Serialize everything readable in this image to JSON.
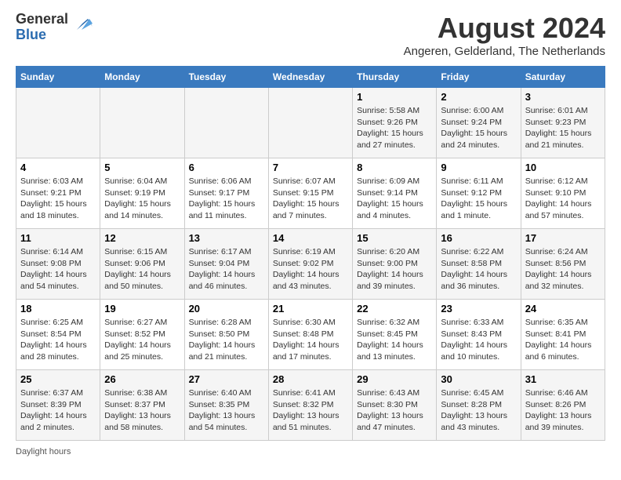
{
  "header": {
    "logo_general": "General",
    "logo_blue": "Blue",
    "month_year": "August 2024",
    "location": "Angeren, Gelderland, The Netherlands"
  },
  "days_of_week": [
    "Sunday",
    "Monday",
    "Tuesday",
    "Wednesday",
    "Thursday",
    "Friday",
    "Saturday"
  ],
  "weeks": [
    [
      {
        "day": "",
        "info": ""
      },
      {
        "day": "",
        "info": ""
      },
      {
        "day": "",
        "info": ""
      },
      {
        "day": "",
        "info": ""
      },
      {
        "day": "1",
        "info": "Sunrise: 5:58 AM\nSunset: 9:26 PM\nDaylight: 15 hours and 27 minutes."
      },
      {
        "day": "2",
        "info": "Sunrise: 6:00 AM\nSunset: 9:24 PM\nDaylight: 15 hours and 24 minutes."
      },
      {
        "day": "3",
        "info": "Sunrise: 6:01 AM\nSunset: 9:23 PM\nDaylight: 15 hours and 21 minutes."
      }
    ],
    [
      {
        "day": "4",
        "info": "Sunrise: 6:03 AM\nSunset: 9:21 PM\nDaylight: 15 hours and 18 minutes."
      },
      {
        "day": "5",
        "info": "Sunrise: 6:04 AM\nSunset: 9:19 PM\nDaylight: 15 hours and 14 minutes."
      },
      {
        "day": "6",
        "info": "Sunrise: 6:06 AM\nSunset: 9:17 PM\nDaylight: 15 hours and 11 minutes."
      },
      {
        "day": "7",
        "info": "Sunrise: 6:07 AM\nSunset: 9:15 PM\nDaylight: 15 hours and 7 minutes."
      },
      {
        "day": "8",
        "info": "Sunrise: 6:09 AM\nSunset: 9:14 PM\nDaylight: 15 hours and 4 minutes."
      },
      {
        "day": "9",
        "info": "Sunrise: 6:11 AM\nSunset: 9:12 PM\nDaylight: 15 hours and 1 minute."
      },
      {
        "day": "10",
        "info": "Sunrise: 6:12 AM\nSunset: 9:10 PM\nDaylight: 14 hours and 57 minutes."
      }
    ],
    [
      {
        "day": "11",
        "info": "Sunrise: 6:14 AM\nSunset: 9:08 PM\nDaylight: 14 hours and 54 minutes."
      },
      {
        "day": "12",
        "info": "Sunrise: 6:15 AM\nSunset: 9:06 PM\nDaylight: 14 hours and 50 minutes."
      },
      {
        "day": "13",
        "info": "Sunrise: 6:17 AM\nSunset: 9:04 PM\nDaylight: 14 hours and 46 minutes."
      },
      {
        "day": "14",
        "info": "Sunrise: 6:19 AM\nSunset: 9:02 PM\nDaylight: 14 hours and 43 minutes."
      },
      {
        "day": "15",
        "info": "Sunrise: 6:20 AM\nSunset: 9:00 PM\nDaylight: 14 hours and 39 minutes."
      },
      {
        "day": "16",
        "info": "Sunrise: 6:22 AM\nSunset: 8:58 PM\nDaylight: 14 hours and 36 minutes."
      },
      {
        "day": "17",
        "info": "Sunrise: 6:24 AM\nSunset: 8:56 PM\nDaylight: 14 hours and 32 minutes."
      }
    ],
    [
      {
        "day": "18",
        "info": "Sunrise: 6:25 AM\nSunset: 8:54 PM\nDaylight: 14 hours and 28 minutes."
      },
      {
        "day": "19",
        "info": "Sunrise: 6:27 AM\nSunset: 8:52 PM\nDaylight: 14 hours and 25 minutes."
      },
      {
        "day": "20",
        "info": "Sunrise: 6:28 AM\nSunset: 8:50 PM\nDaylight: 14 hours and 21 minutes."
      },
      {
        "day": "21",
        "info": "Sunrise: 6:30 AM\nSunset: 8:48 PM\nDaylight: 14 hours and 17 minutes."
      },
      {
        "day": "22",
        "info": "Sunrise: 6:32 AM\nSunset: 8:45 PM\nDaylight: 14 hours and 13 minutes."
      },
      {
        "day": "23",
        "info": "Sunrise: 6:33 AM\nSunset: 8:43 PM\nDaylight: 14 hours and 10 minutes."
      },
      {
        "day": "24",
        "info": "Sunrise: 6:35 AM\nSunset: 8:41 PM\nDaylight: 14 hours and 6 minutes."
      }
    ],
    [
      {
        "day": "25",
        "info": "Sunrise: 6:37 AM\nSunset: 8:39 PM\nDaylight: 14 hours and 2 minutes."
      },
      {
        "day": "26",
        "info": "Sunrise: 6:38 AM\nSunset: 8:37 PM\nDaylight: 13 hours and 58 minutes."
      },
      {
        "day": "27",
        "info": "Sunrise: 6:40 AM\nSunset: 8:35 PM\nDaylight: 13 hours and 54 minutes."
      },
      {
        "day": "28",
        "info": "Sunrise: 6:41 AM\nSunset: 8:32 PM\nDaylight: 13 hours and 51 minutes."
      },
      {
        "day": "29",
        "info": "Sunrise: 6:43 AM\nSunset: 8:30 PM\nDaylight: 13 hours and 47 minutes."
      },
      {
        "day": "30",
        "info": "Sunrise: 6:45 AM\nSunset: 8:28 PM\nDaylight: 13 hours and 43 minutes."
      },
      {
        "day": "31",
        "info": "Sunrise: 6:46 AM\nSunset: 8:26 PM\nDaylight: 13 hours and 39 minutes."
      }
    ]
  ],
  "footer": {
    "daylight_hours": "Daylight hours"
  }
}
